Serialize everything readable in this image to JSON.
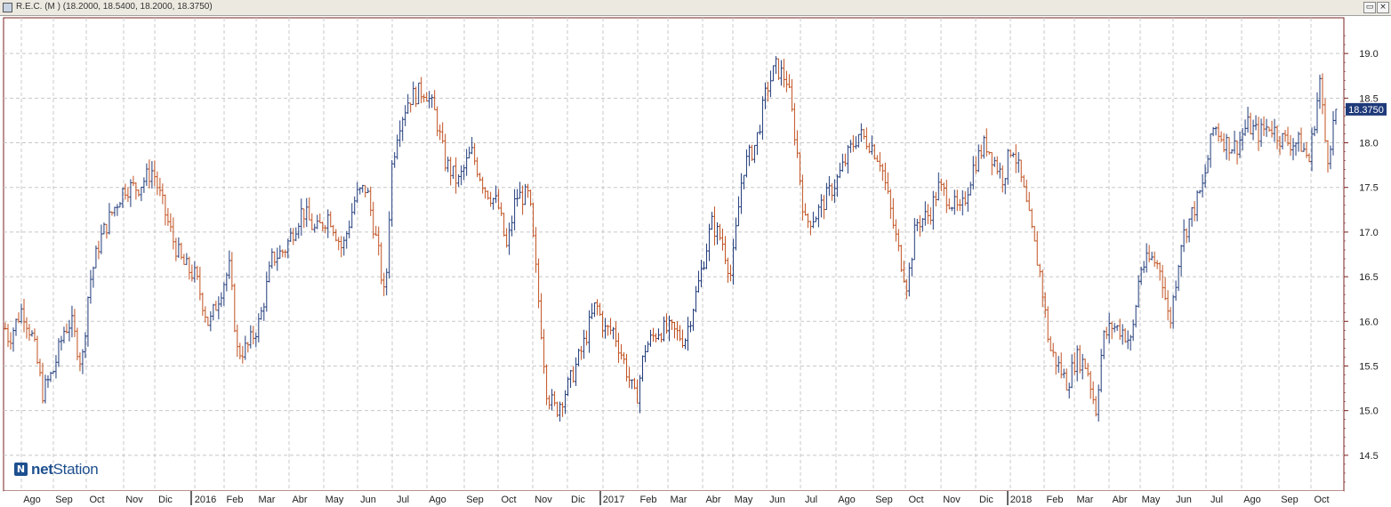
{
  "window": {
    "title": "R.E.C. (M ) (18.2000, 18.5400, 18.2000, 18.3750)",
    "restore_icon": "restore-icon",
    "close_icon": "close-icon",
    "restore_glyph": "▭",
    "close_glyph": "×"
  },
  "logo": {
    "mark": "N",
    "text_bold": "net",
    "text_regular": "Station"
  },
  "colors": {
    "up": "#1f3a7a",
    "down": "#c0501f",
    "grid": "#c8c8c8",
    "axis": "#7a2020",
    "last_price_bg": "#1f3a7a"
  },
  "chart_data": {
    "type": "ohlc",
    "title": "R.E.C. (M ) (18.2000, 18.5400, 18.2000, 18.3750)",
    "ylim": [
      14.1,
      19.4
    ],
    "y_ticks": [
      14.5,
      15.0,
      15.5,
      16.0,
      16.5,
      17.0,
      17.5,
      18.0,
      18.5,
      19.0
    ],
    "y_tick_labels": [
      "14.5",
      "15.0",
      "15.5",
      "16.0",
      "16.5",
      "17.0",
      "17.5",
      "18.0",
      "18.5",
      "19.0"
    ],
    "x_labels": [
      "Ago",
      "Sep",
      "Oct",
      "Nov",
      "Dic",
      "2016",
      "Feb",
      "Mar",
      "Abr",
      "May",
      "Jun",
      "Jul",
      "Ago",
      "Sep",
      "Oct",
      "Nov",
      "Dic",
      "2017",
      "Feb",
      "Mar",
      "Abr",
      "May",
      "Jun",
      "Jul",
      "Ago",
      "Sep",
      "Oct",
      "Nov",
      "Dic",
      "2018",
      "Feb",
      "Mar",
      "Abr",
      "May",
      "Jun",
      "Jul",
      "Ago",
      "Sep",
      "Oct"
    ],
    "last_value": 18.375,
    "last_value_label": "18.3750",
    "grid": true,
    "anchors": [
      [
        0,
        16.1
      ],
      [
        10,
        15.8
      ],
      [
        25,
        16.15
      ],
      [
        37,
        15.8
      ],
      [
        48,
        15.2
      ],
      [
        60,
        15.45
      ],
      [
        72,
        15.9
      ],
      [
        80,
        16.0
      ],
      [
        92,
        15.5
      ],
      [
        100,
        16.4
      ],
      [
        112,
        16.9
      ],
      [
        125,
        17.2
      ],
      [
        140,
        17.5
      ],
      [
        155,
        17.5
      ],
      [
        172,
        17.7
      ],
      [
        180,
        17.4
      ],
      [
        195,
        16.9
      ],
      [
        205,
        16.65
      ],
      [
        220,
        16.5
      ],
      [
        235,
        15.95
      ],
      [
        250,
        16.4
      ],
      [
        258,
        16.6
      ],
      [
        267,
        15.65
      ],
      [
        278,
        15.7
      ],
      [
        292,
        16.0
      ],
      [
        306,
        16.7
      ],
      [
        320,
        16.8
      ],
      [
        340,
        17.25
      ],
      [
        355,
        17.0
      ],
      [
        370,
        17.2
      ],
      [
        385,
        16.8
      ],
      [
        400,
        17.4
      ],
      [
        412,
        17.5
      ],
      [
        425,
        16.8
      ],
      [
        433,
        16.2
      ],
      [
        440,
        17.7
      ],
      [
        448,
        18.2
      ],
      [
        460,
        18.5
      ],
      [
        478,
        18.6
      ],
      [
        490,
        18.3
      ],
      [
        500,
        17.8
      ],
      [
        515,
        17.55
      ],
      [
        530,
        17.9
      ],
      [
        545,
        17.5
      ],
      [
        560,
        17.3
      ],
      [
        570,
        16.8
      ],
      [
        580,
        17.4
      ],
      [
        595,
        17.4
      ],
      [
        605,
        16.3
      ],
      [
        615,
        15.2
      ],
      [
        625,
        15.0
      ],
      [
        640,
        15.3
      ],
      [
        655,
        15.7
      ],
      [
        670,
        16.2
      ],
      [
        680,
        15.9
      ],
      [
        690,
        15.9
      ],
      [
        700,
        15.6
      ],
      [
        715,
        15.1
      ],
      [
        725,
        15.7
      ],
      [
        740,
        15.9
      ],
      [
        755,
        15.9
      ],
      [
        770,
        15.8
      ],
      [
        785,
        16.4
      ],
      [
        800,
        17.1
      ],
      [
        812,
        16.9
      ],
      [
        822,
        16.5
      ],
      [
        835,
        17.7
      ],
      [
        850,
        18.0
      ],
      [
        862,
        18.6
      ],
      [
        872,
        18.85
      ],
      [
        885,
        18.7
      ],
      [
        895,
        18.0
      ],
      [
        905,
        17.1
      ],
      [
        918,
        17.2
      ],
      [
        930,
        17.4
      ],
      [
        942,
        17.6
      ],
      [
        955,
        17.9
      ],
      [
        965,
        18.1
      ],
      [
        978,
        18.0
      ],
      [
        990,
        17.8
      ],
      [
        1000,
        17.3
      ],
      [
        1010,
        16.8
      ],
      [
        1020,
        16.4
      ],
      [
        1030,
        17.1
      ],
      [
        1045,
        17.2
      ],
      [
        1055,
        17.5
      ],
      [
        1065,
        17.4
      ],
      [
        1080,
        17.2
      ],
      [
        1095,
        17.75
      ],
      [
        1108,
        18.0
      ],
      [
        1118,
        17.8
      ],
      [
        1128,
        17.6
      ],
      [
        1138,
        18.0
      ],
      [
        1150,
        17.5
      ],
      [
        1160,
        17.0
      ],
      [
        1170,
        16.5
      ],
      [
        1180,
        15.7
      ],
      [
        1190,
        15.5
      ],
      [
        1200,
        15.3
      ],
      [
        1210,
        15.6
      ],
      [
        1222,
        15.5
      ],
      [
        1232,
        15.0
      ],
      [
        1240,
        15.8
      ],
      [
        1250,
        15.95
      ],
      [
        1262,
        15.9
      ],
      [
        1272,
        15.75
      ],
      [
        1282,
        16.6
      ],
      [
        1295,
        16.7
      ],
      [
        1305,
        16.6
      ],
      [
        1315,
        15.95
      ],
      [
        1328,
        16.9
      ],
      [
        1340,
        17.2
      ],
      [
        1352,
        17.5
      ],
      [
        1365,
        18.2
      ],
      [
        1378,
        18.0
      ],
      [
        1390,
        17.95
      ],
      [
        1402,
        18.2
      ],
      [
        1415,
        18.1
      ],
      [
        1428,
        18.2
      ],
      [
        1440,
        18.05
      ],
      [
        1452,
        18.0
      ],
      [
        1462,
        18.0
      ],
      [
        1472,
        17.8
      ],
      [
        1484,
        18.7
      ],
      [
        1492,
        17.8
      ],
      [
        1502,
        18.375
      ]
    ]
  }
}
